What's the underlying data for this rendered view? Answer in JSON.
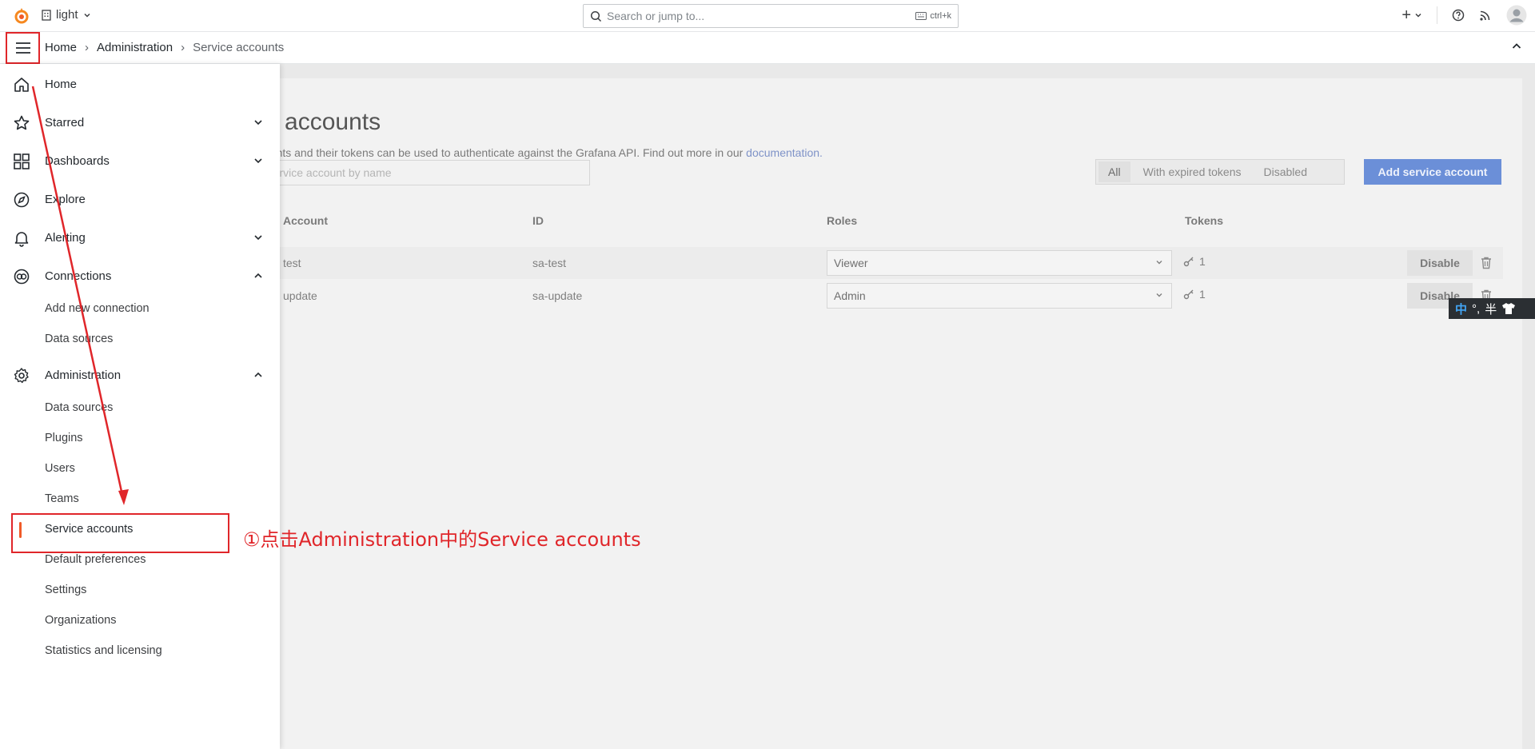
{
  "topbar": {
    "org_label": "light",
    "search_placeholder": "Search or jump to...",
    "search_shortcut": "ctrl+k",
    "add_label": "+"
  },
  "breadcrumb": [
    "Home",
    "Administration",
    "Service accounts"
  ],
  "page": {
    "title_visible": "ce accounts",
    "description_visible": "ccounts and their tokens can be used to authenticate against the Grafana API. Find out more in our",
    "doc_link": "documentation.",
    "search_placeholder_visible": "h service account by name",
    "filters": [
      "All",
      "With expired tokens",
      "Disabled"
    ],
    "active_filter": "All",
    "add_button": "Add service account"
  },
  "table": {
    "headers": [
      "Account",
      "ID",
      "Roles",
      "Tokens"
    ],
    "rows": [
      {
        "account": "test",
        "id": "sa-test",
        "role": "Viewer",
        "tokens": "1",
        "action": "Disable"
      },
      {
        "account": "update",
        "id": "sa-update",
        "role": "Admin",
        "tokens": "1",
        "action": "Disable"
      }
    ]
  },
  "sidebar": {
    "items": [
      {
        "label": "Home",
        "icon": "home-icon"
      },
      {
        "label": "Starred",
        "icon": "star-icon"
      },
      {
        "label": "Dashboards",
        "icon": "apps-icon"
      },
      {
        "label": "Explore",
        "icon": "compass-icon"
      },
      {
        "label": "Alerting",
        "icon": "bell-icon"
      },
      {
        "label": "Connections",
        "icon": "connections-icon"
      },
      {
        "label": "Administration",
        "icon": "gear-icon"
      }
    ],
    "connections_sub": [
      "Add new connection",
      "Data sources"
    ],
    "admin_sub": [
      "Data sources",
      "Plugins",
      "Users",
      "Teams",
      "Service accounts",
      "Default preferences",
      "Settings",
      "Organizations",
      "Statistics and licensing"
    ]
  },
  "annotation": "①点击Administration中的Service accounts",
  "ime": {
    "lang": "中",
    "punct": "°,",
    "width": "半"
  },
  "colors": {
    "accent": "#f05a28",
    "annotation_red": "#e0262a",
    "primary_blue": "#3d71d9"
  }
}
